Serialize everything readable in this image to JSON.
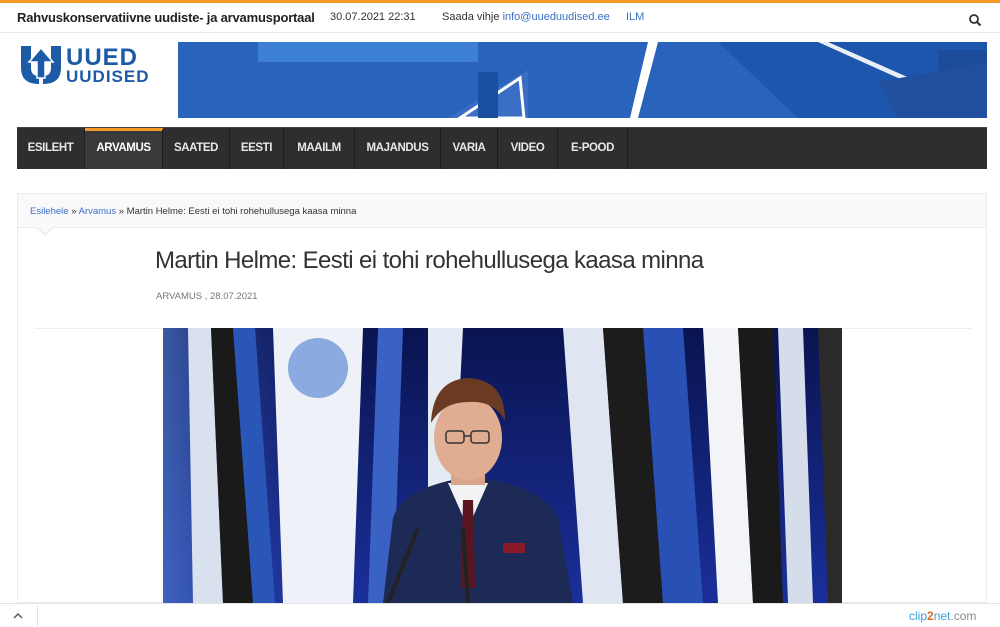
{
  "topbar": {
    "tagline": "Rahvuskonservatiivne uudiste- ja arvamusportaal",
    "datetime": "30.07.2021 22:31",
    "tip_label": "Saada vihje",
    "tip_email": "info@uueduudised.ee",
    "weather": "ILM",
    "search_icon": "search-icon"
  },
  "logo": {
    "line1": "UUED",
    "line2": "UUDISED"
  },
  "nav": {
    "items": [
      {
        "label": "ESILEHT"
      },
      {
        "label": "ARVAMUS",
        "active": true
      },
      {
        "label": "SAATED"
      },
      {
        "label": "EESTI"
      },
      {
        "label": "MAAILM"
      },
      {
        "label": "MAJANDUS"
      },
      {
        "label": "VARIA"
      },
      {
        "label": "VIDEO"
      },
      {
        "label": "E-POOD"
      }
    ]
  },
  "breadcrumb": {
    "home": "Esilehele",
    "sep1": " » ",
    "section": "Arvamus",
    "sep2": " » ",
    "current": "Martin Helme: Eesti ei tohi rohehullusega kaasa minna"
  },
  "article": {
    "title": "Martin Helme: Eesti ei tohi rohehullusega kaasa minna",
    "meta": "ARVAMUS , 28.07.2021"
  },
  "footer": {
    "brand_a": "clip",
    "brand_b": "2",
    "brand_c": "net",
    "brand_tld": ".com"
  },
  "colors": {
    "accent": "#f39a2a",
    "link": "#3b6fc7",
    "nav_bg": "#2e2e2e",
    "logo_blue": "#1d5ba6"
  }
}
